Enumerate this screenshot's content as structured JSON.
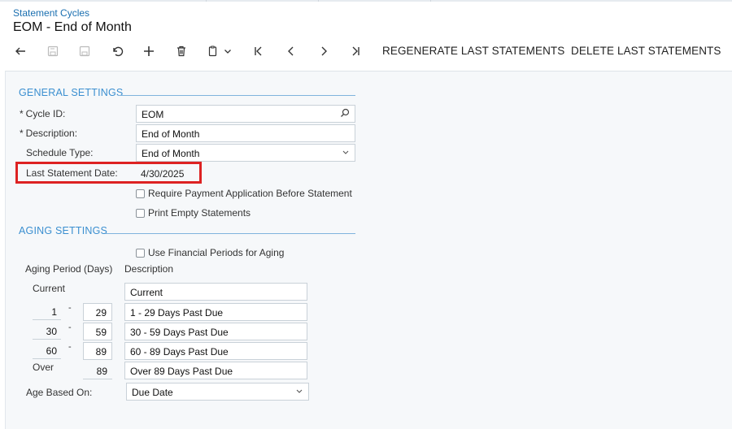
{
  "header": {
    "breadcrumb": "Statement Cycles",
    "title": "EOM - End of Month"
  },
  "toolbar": {
    "icons": [
      "back-icon",
      "save-close-icon",
      "save-icon",
      "undo-icon",
      "add-icon",
      "delete-icon",
      "copy-paste-icon",
      "chevron-down-icon",
      "first-record-icon",
      "prev-record-icon",
      "next-record-icon",
      "last-record-icon"
    ],
    "regenerate_label": "REGENERATE LAST STATEMENTS",
    "delete_label": "DELETE LAST STATEMENTS"
  },
  "general": {
    "header": "GENERAL SETTINGS",
    "cycle_id_label": "Cycle ID:",
    "cycle_id_value": "EOM",
    "description_label": "Description:",
    "description_value": "End of Month",
    "schedule_type_label": "Schedule Type:",
    "schedule_type_value": "End of Month",
    "last_statement_label": "Last Statement Date:",
    "last_statement_value": "4/30/2025",
    "require_payment_label": "Require Payment Application Before Statement",
    "print_empty_label": "Print Empty Statements",
    "required_mark": "*"
  },
  "aging": {
    "header": "AGING SETTINGS",
    "use_fin_periods_label": "Use Financial Periods for Aging",
    "period_col_label": "Aging Period (Days)",
    "description_col_label": "Description",
    "current_label": "Current",
    "current_desc": "Current",
    "rows": [
      {
        "from": "1",
        "to": "29",
        "desc": "1 - 29 Days Past Due"
      },
      {
        "from": "30",
        "to": "59",
        "desc": "30 - 59 Days Past Due"
      },
      {
        "from": "60",
        "to": "89",
        "desc": "60 - 89 Days Past Due"
      }
    ],
    "dash": "-",
    "over_label": "Over",
    "over_value": "89",
    "over_desc": "Over 89 Days Past Due",
    "age_based_label": "Age Based On:",
    "age_based_value": "Due Date"
  }
}
